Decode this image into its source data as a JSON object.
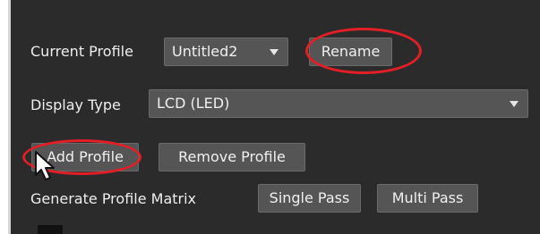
{
  "profile": {
    "current_profile_label": "Current Profile",
    "current_profile_value": "Untitled2",
    "rename_label": "Rename"
  },
  "display": {
    "display_type_label": "Display Type",
    "display_type_value": "LCD (LED)"
  },
  "actions": {
    "add_profile_label": "Add Profile",
    "remove_profile_label": "Remove Profile"
  },
  "matrix": {
    "generate_label": "Generate Profile Matrix",
    "single_pass_label": "Single Pass",
    "multi_pass_label": "Multi Pass"
  },
  "annotations": {
    "highlight_color": "#e21f26",
    "cursor_icon": "mouse-pointer-icon"
  }
}
